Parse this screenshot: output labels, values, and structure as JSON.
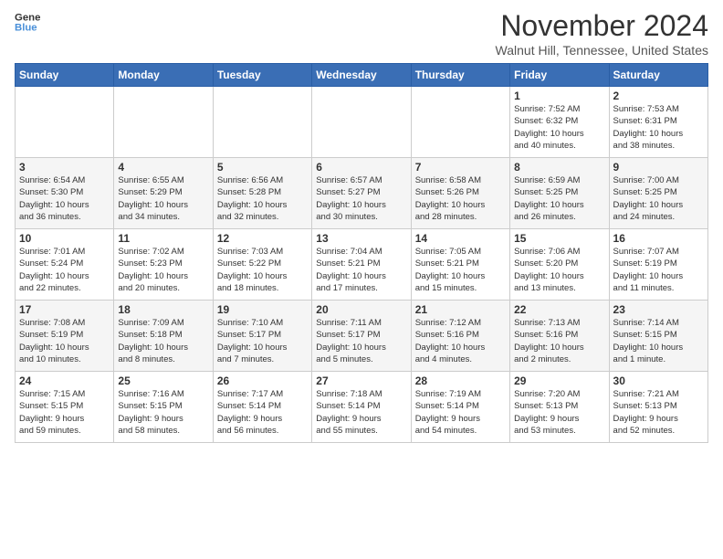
{
  "logo": {
    "line1": "General",
    "line2": "Blue"
  },
  "title": "November 2024",
  "location": "Walnut Hill, Tennessee, United States",
  "days_of_week": [
    "Sunday",
    "Monday",
    "Tuesday",
    "Wednesday",
    "Thursday",
    "Friday",
    "Saturday"
  ],
  "weeks": [
    [
      {
        "day": "",
        "info": ""
      },
      {
        "day": "",
        "info": ""
      },
      {
        "day": "",
        "info": ""
      },
      {
        "day": "",
        "info": ""
      },
      {
        "day": "",
        "info": ""
      },
      {
        "day": "1",
        "info": "Sunrise: 7:52 AM\nSunset: 6:32 PM\nDaylight: 10 hours\nand 40 minutes."
      },
      {
        "day": "2",
        "info": "Sunrise: 7:53 AM\nSunset: 6:31 PM\nDaylight: 10 hours\nand 38 minutes."
      }
    ],
    [
      {
        "day": "3",
        "info": "Sunrise: 6:54 AM\nSunset: 5:30 PM\nDaylight: 10 hours\nand 36 minutes."
      },
      {
        "day": "4",
        "info": "Sunrise: 6:55 AM\nSunset: 5:29 PM\nDaylight: 10 hours\nand 34 minutes."
      },
      {
        "day": "5",
        "info": "Sunrise: 6:56 AM\nSunset: 5:28 PM\nDaylight: 10 hours\nand 32 minutes."
      },
      {
        "day": "6",
        "info": "Sunrise: 6:57 AM\nSunset: 5:27 PM\nDaylight: 10 hours\nand 30 minutes."
      },
      {
        "day": "7",
        "info": "Sunrise: 6:58 AM\nSunset: 5:26 PM\nDaylight: 10 hours\nand 28 minutes."
      },
      {
        "day": "8",
        "info": "Sunrise: 6:59 AM\nSunset: 5:25 PM\nDaylight: 10 hours\nand 26 minutes."
      },
      {
        "day": "9",
        "info": "Sunrise: 7:00 AM\nSunset: 5:25 PM\nDaylight: 10 hours\nand 24 minutes."
      }
    ],
    [
      {
        "day": "10",
        "info": "Sunrise: 7:01 AM\nSunset: 5:24 PM\nDaylight: 10 hours\nand 22 minutes."
      },
      {
        "day": "11",
        "info": "Sunrise: 7:02 AM\nSunset: 5:23 PM\nDaylight: 10 hours\nand 20 minutes."
      },
      {
        "day": "12",
        "info": "Sunrise: 7:03 AM\nSunset: 5:22 PM\nDaylight: 10 hours\nand 18 minutes."
      },
      {
        "day": "13",
        "info": "Sunrise: 7:04 AM\nSunset: 5:21 PM\nDaylight: 10 hours\nand 17 minutes."
      },
      {
        "day": "14",
        "info": "Sunrise: 7:05 AM\nSunset: 5:21 PM\nDaylight: 10 hours\nand 15 minutes."
      },
      {
        "day": "15",
        "info": "Sunrise: 7:06 AM\nSunset: 5:20 PM\nDaylight: 10 hours\nand 13 minutes."
      },
      {
        "day": "16",
        "info": "Sunrise: 7:07 AM\nSunset: 5:19 PM\nDaylight: 10 hours\nand 11 minutes."
      }
    ],
    [
      {
        "day": "17",
        "info": "Sunrise: 7:08 AM\nSunset: 5:19 PM\nDaylight: 10 hours\nand 10 minutes."
      },
      {
        "day": "18",
        "info": "Sunrise: 7:09 AM\nSunset: 5:18 PM\nDaylight: 10 hours\nand 8 minutes."
      },
      {
        "day": "19",
        "info": "Sunrise: 7:10 AM\nSunset: 5:17 PM\nDaylight: 10 hours\nand 7 minutes."
      },
      {
        "day": "20",
        "info": "Sunrise: 7:11 AM\nSunset: 5:17 PM\nDaylight: 10 hours\nand 5 minutes."
      },
      {
        "day": "21",
        "info": "Sunrise: 7:12 AM\nSunset: 5:16 PM\nDaylight: 10 hours\nand 4 minutes."
      },
      {
        "day": "22",
        "info": "Sunrise: 7:13 AM\nSunset: 5:16 PM\nDaylight: 10 hours\nand 2 minutes."
      },
      {
        "day": "23",
        "info": "Sunrise: 7:14 AM\nSunset: 5:15 PM\nDaylight: 10 hours\nand 1 minute."
      }
    ],
    [
      {
        "day": "24",
        "info": "Sunrise: 7:15 AM\nSunset: 5:15 PM\nDaylight: 9 hours\nand 59 minutes."
      },
      {
        "day": "25",
        "info": "Sunrise: 7:16 AM\nSunset: 5:15 PM\nDaylight: 9 hours\nand 58 minutes."
      },
      {
        "day": "26",
        "info": "Sunrise: 7:17 AM\nSunset: 5:14 PM\nDaylight: 9 hours\nand 56 minutes."
      },
      {
        "day": "27",
        "info": "Sunrise: 7:18 AM\nSunset: 5:14 PM\nDaylight: 9 hours\nand 55 minutes."
      },
      {
        "day": "28",
        "info": "Sunrise: 7:19 AM\nSunset: 5:14 PM\nDaylight: 9 hours\nand 54 minutes."
      },
      {
        "day": "29",
        "info": "Sunrise: 7:20 AM\nSunset: 5:13 PM\nDaylight: 9 hours\nand 53 minutes."
      },
      {
        "day": "30",
        "info": "Sunrise: 7:21 AM\nSunset: 5:13 PM\nDaylight: 9 hours\nand 52 minutes."
      }
    ]
  ]
}
